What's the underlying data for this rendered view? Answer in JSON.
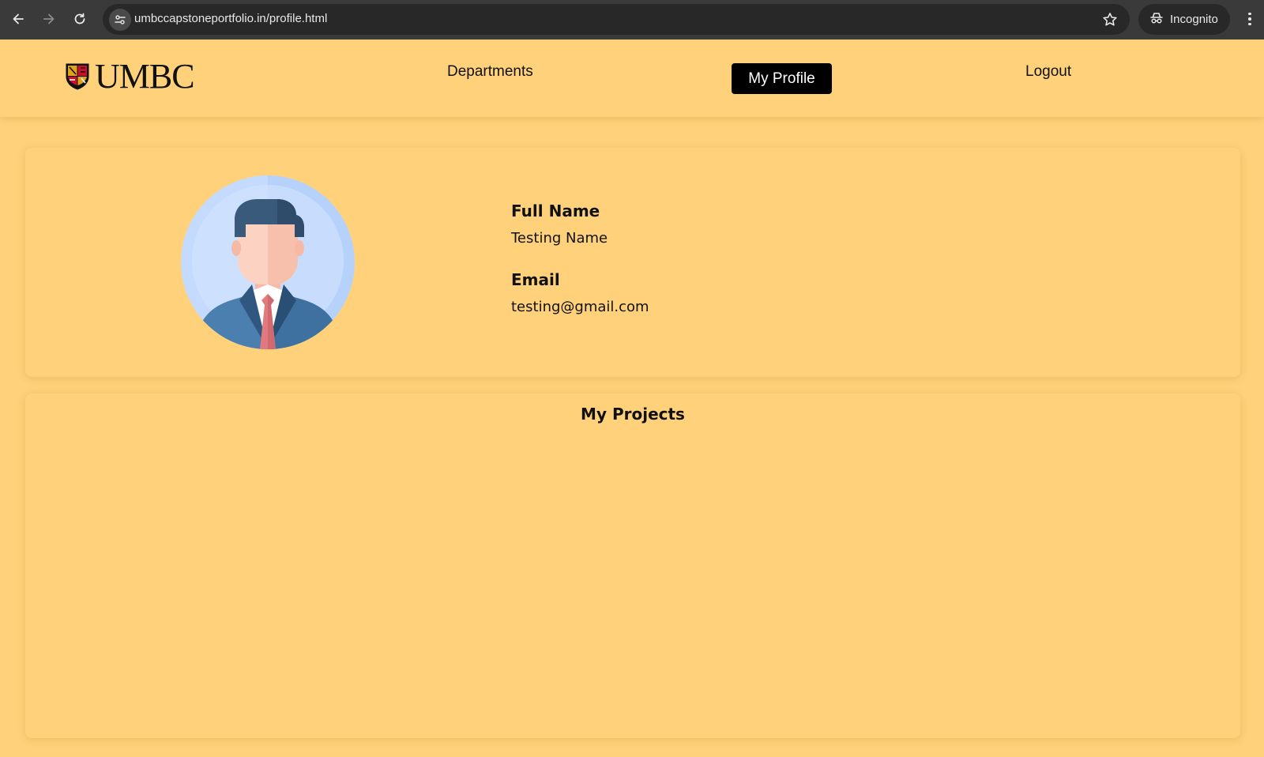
{
  "browser": {
    "url": "umbccapstoneportfolio.in/profile.html",
    "incognito_label": "Incognito",
    "icons": [
      "back-arrow-icon",
      "forward-arrow-icon",
      "reload-icon",
      "tune-icon",
      "star-icon",
      "incognito-icon",
      "kebab-menu-icon"
    ]
  },
  "header": {
    "logo_text": "UMBC",
    "nav": {
      "departments": "Departments",
      "my_profile": "My Profile",
      "logout": "Logout"
    }
  },
  "profile": {
    "full_name_label": "Full Name",
    "full_name_value": "Testing Name",
    "email_label": "Email",
    "email_value": "testing@gmail.com"
  },
  "projects": {
    "title": "My Projects",
    "items": []
  },
  "colors": {
    "page_bg": "#fed17a",
    "active_nav_bg": "#000000",
    "chrome_bg": "#3a3a3a"
  }
}
